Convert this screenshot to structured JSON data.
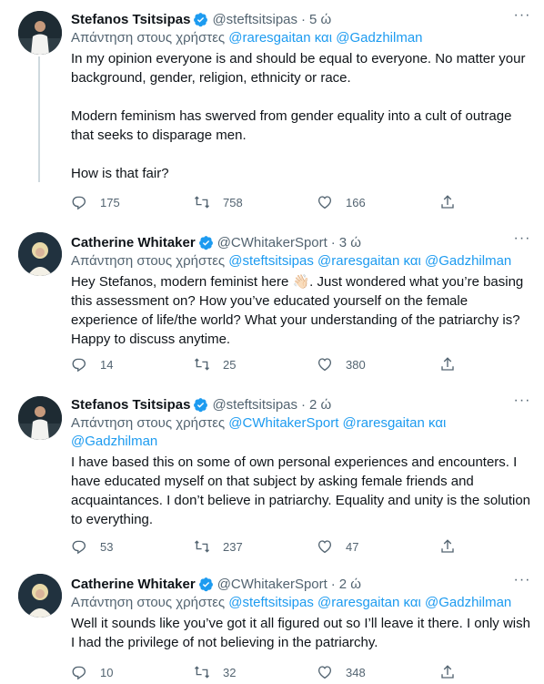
{
  "tweets": [
    {
      "name": "Stefanos Tsitsipas",
      "handle": "@steftsitsipas",
      "time": "5 ώ",
      "replying_prefix": "Απάντηση στους χρήστες",
      "mention1": "@raresgaitan",
      "conj": "και",
      "mention2": "@Gadzhilman",
      "text": "In my opinion everyone is and should be equal to everyone. No matter your background, gender, religion, ethnicity or race.\n\nModern feminism has swerved from gender equality into a cult of outrage that seeks to disparage men.\n\nHow is that fair?",
      "replies": "175",
      "retweets": "758",
      "likes": "166"
    },
    {
      "name": "Catherine Whitaker",
      "handle": "@CWhitakerSport",
      "time": "3 ώ",
      "replying_prefix": "Απάντηση στους χρήστες",
      "mention1": "@steftsitsipas",
      "mention2": "@raresgaitan",
      "conj": "και",
      "mention3": "@Gadzhilman",
      "text_a": "Hey Stefanos, modern feminist here ",
      "emoji": "👋🏻",
      "text_b": ". Just wondered what you’re basing this assessment on? How you’ve educated yourself on the female experience of life/the world? What your understanding of the patriarchy is? Happy to discuss anytime.",
      "replies": "14",
      "retweets": "25",
      "likes": "380"
    },
    {
      "name": "Stefanos Tsitsipas",
      "handle": "@steftsitsipas",
      "time": "2 ώ",
      "replying_prefix": "Απάντηση στους χρήστες",
      "mention1": "@CWhitakerSport",
      "mention2": "@raresgaitan",
      "conj": "και",
      "mention3": "@Gadzhilman",
      "text": "I have based this on some of own personal experiences and encounters. I have educated myself on that subject by asking female friends and acquaintances. I don’t believe in patriarchy. Equality and unity is the solution to everything.",
      "replies": "53",
      "retweets": "237",
      "likes": "47"
    },
    {
      "name": "Catherine Whitaker",
      "handle": "@CWhitakerSport",
      "time": "2 ώ",
      "replying_prefix": "Απάντηση στους χρήστες",
      "mention1": "@steftsitsipas",
      "mention2": "@raresgaitan",
      "conj": "και",
      "mention3": "@Gadzhilman",
      "text": "Well it sounds like you’ve got it all figured out so I’ll leave it there. I only wish I had the privilege of not believing in the patriarchy.",
      "replies": "10",
      "retweets": "32",
      "likes": "348"
    }
  ],
  "colors": {
    "accent": "#1d9bf0",
    "muted": "#536471",
    "text": "#0f1419"
  },
  "icons": [
    "verified-badge-icon",
    "more-icon",
    "reply-icon",
    "retweet-icon",
    "like-icon",
    "share-icon"
  ]
}
